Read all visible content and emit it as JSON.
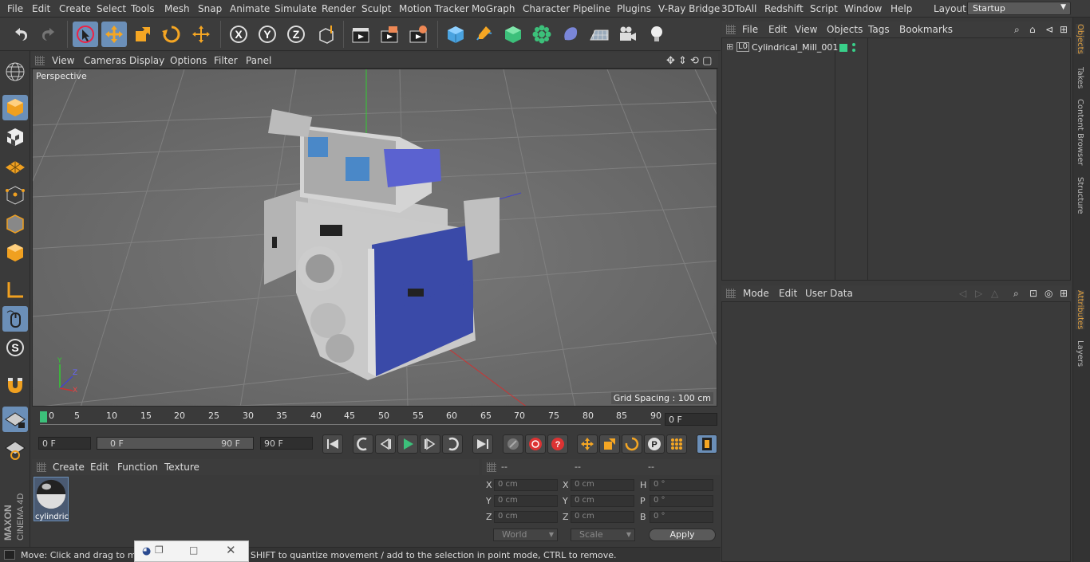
{
  "menubar": {
    "items": [
      "File",
      "Edit",
      "Create",
      "Select",
      "Tools",
      "Mesh",
      "Snap",
      "Animate",
      "Simulate",
      "Render",
      "Sculpt",
      "Motion Tracker",
      "MoGraph",
      "Character",
      "Pipeline",
      "Plugins",
      "V-Ray Bridge",
      "3DToAll",
      "Redshift",
      "Script",
      "Window",
      "Help"
    ],
    "layout_label": "Layout:",
    "layout_value": "Startup"
  },
  "toolbar": {
    "axis_x": "X",
    "axis_y": "Y",
    "axis_z": "Z"
  },
  "viewport_menu": {
    "items": [
      "View",
      "Cameras",
      "Display",
      "Options",
      "Filter",
      "Panel"
    ]
  },
  "viewport": {
    "label": "Perspective",
    "grid_spacing": "Grid Spacing : 100 cm"
  },
  "timeline": {
    "ticks": [
      "0",
      "5",
      "10",
      "15",
      "20",
      "25",
      "30",
      "35",
      "40",
      "45",
      "50",
      "55",
      "60",
      "65",
      "70",
      "75",
      "80",
      "85",
      "90"
    ],
    "current_frame": "0 F"
  },
  "transport": {
    "start_field": "0 F",
    "range_start": "0 F",
    "range_end": "90 F",
    "end_field": "90 F"
  },
  "material_manager": {
    "menu": [
      "Create",
      "Edit",
      "Function",
      "Texture"
    ],
    "material_name": "cylindric"
  },
  "coordinates": {
    "header": [
      "--",
      "--",
      "--"
    ],
    "rows": [
      {
        "a": "X",
        "av": "0 cm",
        "b": "X",
        "bv": "0 cm",
        "c": "H",
        "cv": "0 °"
      },
      {
        "a": "Y",
        "av": "0 cm",
        "b": "Y",
        "bv": "0 cm",
        "c": "P",
        "cv": "0 °"
      },
      {
        "a": "Z",
        "av": "0 cm",
        "b": "Z",
        "bv": "0 cm",
        "c": "B",
        "cv": "0 °"
      }
    ],
    "world": "World",
    "scale": "Scale",
    "apply": "Apply"
  },
  "status": {
    "text": "Move: Click and drag to move elements. Hold down SHIFT to quantize movement / add to the selection in point mode, CTRL to remove."
  },
  "object_manager": {
    "menu": [
      "File",
      "Edit",
      "View",
      "Objects",
      "Tags",
      "Bookmarks"
    ],
    "objects": [
      {
        "name": "Cylindrical_Mill_001"
      }
    ]
  },
  "attributes": {
    "menu": [
      "Mode",
      "Edit",
      "User Data"
    ]
  },
  "right_tabs": [
    "Objects",
    "Takes",
    "Content Browser",
    "Structure",
    "Attributes",
    "Layers"
  ],
  "colors": {
    "accent": "#6b8fb8",
    "tag_green": "#39d08a",
    "tab_active": "#e0a040"
  }
}
